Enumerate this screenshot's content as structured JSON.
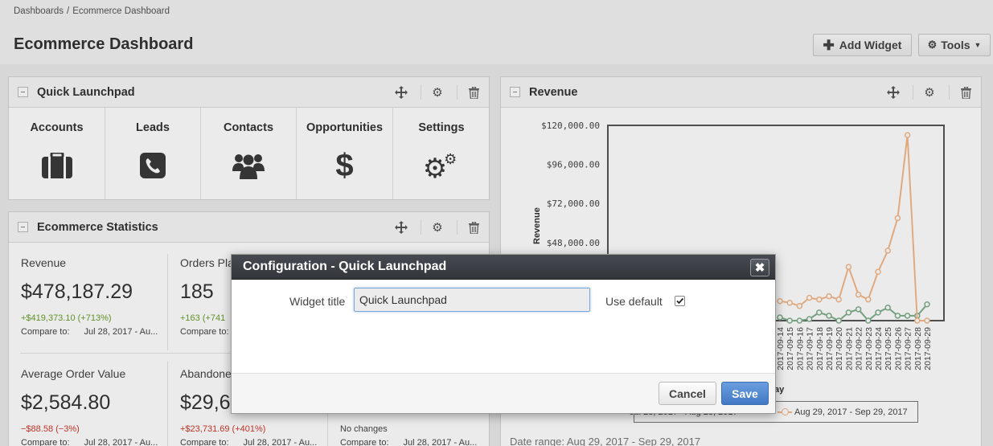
{
  "breadcrumb": {
    "root": "Dashboards",
    "separator": "/",
    "current": "Ecommerce Dashboard"
  },
  "page_title": "Ecommerce Dashboard",
  "toolbar": {
    "add_widget_label": "Add Widget",
    "tools_label": "Tools"
  },
  "launchpad": {
    "title": "Quick Launchpad",
    "items": [
      {
        "label": "Accounts",
        "icon": "briefcase-icon"
      },
      {
        "label": "Leads",
        "icon": "phone-icon"
      },
      {
        "label": "Contacts",
        "icon": "users-icon"
      },
      {
        "label": "Opportunities",
        "icon": "dollar-icon"
      },
      {
        "label": "Settings",
        "icon": "gears-icon"
      }
    ]
  },
  "stats": {
    "title": "Ecommerce Statistics",
    "compare_label": "Compare to:",
    "items": [
      {
        "label": "Revenue",
        "value": "$478,187.29",
        "change": "+$419,373.10 (+713%)",
        "compare_date": "Jul 28, 2017 - Au..."
      },
      {
        "label": "Orders Pla",
        "value": "185",
        "change": "+163 (+741",
        "compare_date": ""
      },
      {
        "label": "Average Order Value",
        "value": "$2,584.80",
        "change": "−$88.58 (−3%)",
        "compare_date": "Jul 28, 2017 - Au..."
      },
      {
        "label": "Abandone",
        "value": "$29,6",
        "change": "+$23,731.69 (+401%)",
        "compare_date": "Jul 28, 2017 - Au..."
      },
      {
        "label": "",
        "value": "",
        "change": "No changes",
        "compare_date": "Jul 28, 2017 - Au..."
      }
    ]
  },
  "revenue": {
    "title": "Revenue",
    "date_range": "Date range: Aug 29, 2017 - Sep 29, 2017",
    "legend_current": "Aug 29, 2017 - Sep 29, 2017",
    "legend_prev_partial": "Jul 28, 2017 - Aug 28, 2017",
    "axis_xlabel_partial": "ay"
  },
  "chart_data": {
    "type": "line",
    "title": "",
    "xlabel": "Day",
    "ylabel": "Revenue",
    "ylim": [
      0,
      120000
    ],
    "y_ticks": [
      "$120,000.00",
      "$96,000.00",
      "$72,000.00",
      "$48,000.00"
    ],
    "x": [
      "2017-09-14",
      "2017-09-15",
      "2017-09-16",
      "2017-09-17",
      "2017-09-18",
      "2017-09-19",
      "2017-09-20",
      "2017-09-21",
      "2017-09-22",
      "2017-09-23",
      "2017-09-24",
      "2017-09-25",
      "2017-09-26",
      "2017-09-27",
      "2017-09-28",
      "2017-09-29"
    ],
    "series": [
      {
        "name": "Aug 29, 2017 - Sep 29, 2017",
        "color": "#f4b88a",
        "values": [
          12000,
          11000,
          9000,
          14000,
          13000,
          15000,
          13000,
          33000,
          16000,
          13000,
          30000,
          43000,
          63000,
          114000,
          0,
          0
        ]
      },
      {
        "name": "Jul 28, 2017 - Aug 28, 2017",
        "color": "#7fae8a",
        "values": [
          2000,
          0,
          0,
          1000,
          5000,
          3000,
          0,
          5000,
          7000,
          0,
          5000,
          8000,
          3000,
          3000,
          3000,
          10000
        ]
      }
    ],
    "legend": "bottom"
  },
  "modal": {
    "title": "Configuration - Quick Launchpad",
    "close_glyph": "✖",
    "field_label": "Widget title",
    "field_value": "Quick Launchpad",
    "use_default_label": "Use default",
    "use_default_checked": true,
    "cancel_label": "Cancel",
    "save_label": "Save"
  },
  "colors": {
    "save_button": "#4f86cf",
    "orange_series": "#f4b88a",
    "green_series": "#7fae8a"
  }
}
